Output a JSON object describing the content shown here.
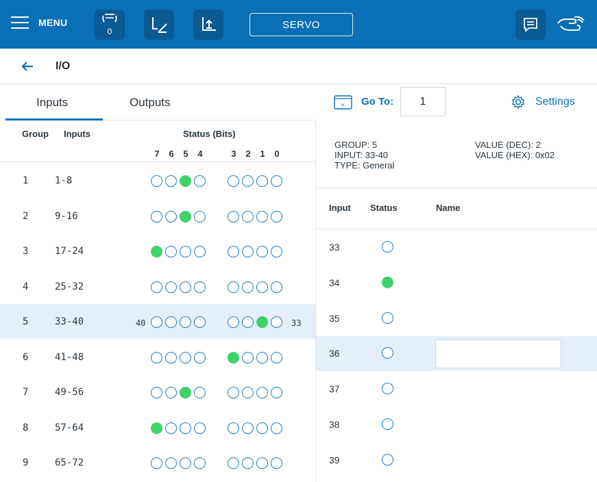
{
  "topbar": {
    "menu_label": "MENU",
    "gripper_count": "0",
    "servo_label": "SERVO"
  },
  "crumb": {
    "title": "I/O"
  },
  "tabs": [
    {
      "label": "Inputs",
      "active": true
    },
    {
      "label": "Outputs",
      "active": false
    }
  ],
  "goto": {
    "label": "Go To:",
    "value": "1"
  },
  "settings": {
    "label": "Settings"
  },
  "table": {
    "headers": {
      "group": "Group",
      "inputs": "Inputs",
      "status": "Status (Bits)"
    },
    "bit_labels": [
      "7",
      "6",
      "5",
      "4",
      "3",
      "2",
      "1",
      "0"
    ],
    "rows": [
      {
        "group": "1",
        "range": "1-8",
        "bits": [
          0,
          0,
          1,
          0,
          0,
          0,
          0,
          0
        ]
      },
      {
        "group": "2",
        "range": "9-16",
        "bits": [
          0,
          0,
          1,
          0,
          0,
          0,
          0,
          0
        ]
      },
      {
        "group": "3",
        "range": "17-24",
        "bits": [
          1,
          0,
          0,
          0,
          0,
          0,
          0,
          0
        ]
      },
      {
        "group": "4",
        "range": "25-32",
        "bits": [
          0,
          0,
          0,
          0,
          0,
          0,
          0,
          0
        ]
      },
      {
        "group": "5",
        "range": "33-40",
        "bits": [
          0,
          0,
          0,
          0,
          0,
          0,
          1,
          0
        ],
        "selected": true,
        "left_edge": "40",
        "right_edge": "33"
      },
      {
        "group": "6",
        "range": "41-48",
        "bits": [
          0,
          0,
          0,
          0,
          1,
          0,
          0,
          0
        ]
      },
      {
        "group": "7",
        "range": "49-56",
        "bits": [
          0,
          0,
          1,
          0,
          0,
          0,
          0,
          0
        ]
      },
      {
        "group": "8",
        "range": "57-64",
        "bits": [
          1,
          0,
          0,
          0,
          0,
          0,
          0,
          0
        ]
      },
      {
        "group": "9",
        "range": "65-72",
        "bits": [
          0,
          0,
          0,
          0,
          0,
          0,
          0,
          0
        ]
      }
    ]
  },
  "detail": {
    "group": "GROUP: 5",
    "input": "INPUT: 33-40",
    "type": "TYPE: General",
    "value_dec": "VALUE (DEC): 2",
    "value_hex": "VALUE (HEX): 0x02",
    "headers": {
      "input": "Input",
      "status": "Status",
      "name": "Name"
    },
    "rows": [
      {
        "input": "33",
        "on": false
      },
      {
        "input": "34",
        "on": true
      },
      {
        "input": "35",
        "on": false
      },
      {
        "input": "36",
        "on": false,
        "selected": true,
        "name": ""
      },
      {
        "input": "37",
        "on": false
      },
      {
        "input": "38",
        "on": false
      },
      {
        "input": "39",
        "on": false
      }
    ]
  },
  "colors": {
    "brand": "#0b6fb5",
    "on": "#3ed26a",
    "selected_row": "#e4effa"
  }
}
